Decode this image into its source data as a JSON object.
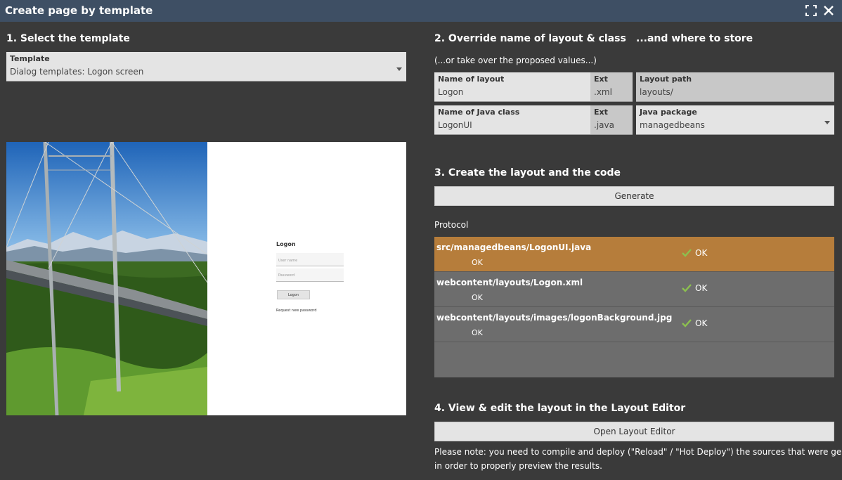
{
  "window": {
    "title": "Create page by template"
  },
  "section1": {
    "heading": "1. Select the template",
    "template_label": "Template",
    "template_value": "Dialog templates: Logon screen"
  },
  "preview": {
    "title": "Logon",
    "username_placeholder": "User name",
    "password_placeholder": "Password",
    "button": "Logon",
    "link": "Request new password"
  },
  "section2": {
    "heading": "2. Override name of layout & class",
    "heading_store": "...and where to store",
    "hint": "(...or take over the proposed values...)",
    "layout_name_label": "Name of layout",
    "layout_name_value": "Logon",
    "layout_ext_label": "Ext",
    "layout_ext_value": ".xml",
    "layout_path_label": "Layout path",
    "layout_path_value": "layouts/",
    "class_name_label": "Name of Java class",
    "class_name_value": "LogonUI",
    "class_ext_label": "Ext",
    "class_ext_value": ".java",
    "package_label": "Java package",
    "package_value": "managedbeans"
  },
  "section3": {
    "heading": "3. Create the layout and the code",
    "generate_label": "Generate",
    "protocol_label": "Protocol",
    "rows": [
      {
        "file": "src/managedbeans/LogonUI.java",
        "sub": "OK",
        "status": "OK"
      },
      {
        "file": "webcontent/layouts/Logon.xml",
        "sub": "OK",
        "status": "OK"
      },
      {
        "file": "webcontent/layouts/images/logonBackground.jpg",
        "sub": "OK",
        "status": "OK"
      }
    ]
  },
  "section4": {
    "heading": "4. View & edit the layout in the Layout Editor",
    "open_label": "Open Layout Editor",
    "note_line1": "Please note: you need to compile and deploy (\"Reload\" / \"Hot Deploy\") the sources that were genereated",
    "note_line2": "in order to properly preview the results."
  },
  "colors": {
    "titlebar": "#3e4f64",
    "background": "#3a3a3a",
    "selected_row": "#b67d3b",
    "check": "#8cc04f"
  }
}
